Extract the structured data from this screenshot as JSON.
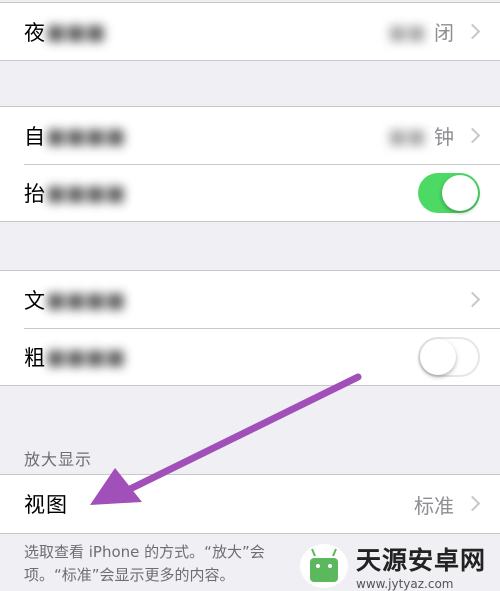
{
  "settings": {
    "group1": {
      "row1": {
        "label": "夜",
        "value": "闭"
      }
    },
    "group2": {
      "row1": {
        "label": "自",
        "value": "钟"
      },
      "row2": {
        "label": "抬",
        "toggle": "on"
      }
    },
    "group3": {
      "row1": {
        "label": "文"
      },
      "row2": {
        "label": "粗",
        "toggle": "off"
      }
    },
    "zoom_section": {
      "header": "放大显示",
      "row": {
        "label": "视图",
        "value": "标准"
      },
      "footer_line1": "选取查看 iPhone 的方式。“放大”会",
      "footer_line2": "项。“标准”会显示更多的内容。"
    }
  },
  "watermark": {
    "title": "天源安卓网",
    "url": "www.jytyaz.com"
  },
  "colors": {
    "toggle_on": "#4cd964",
    "arrow": "#a050b8",
    "background": "#efeff4"
  },
  "icons": [
    "chevron-right-icon",
    "arrow-annotation-icon",
    "site-logo-icon"
  ]
}
